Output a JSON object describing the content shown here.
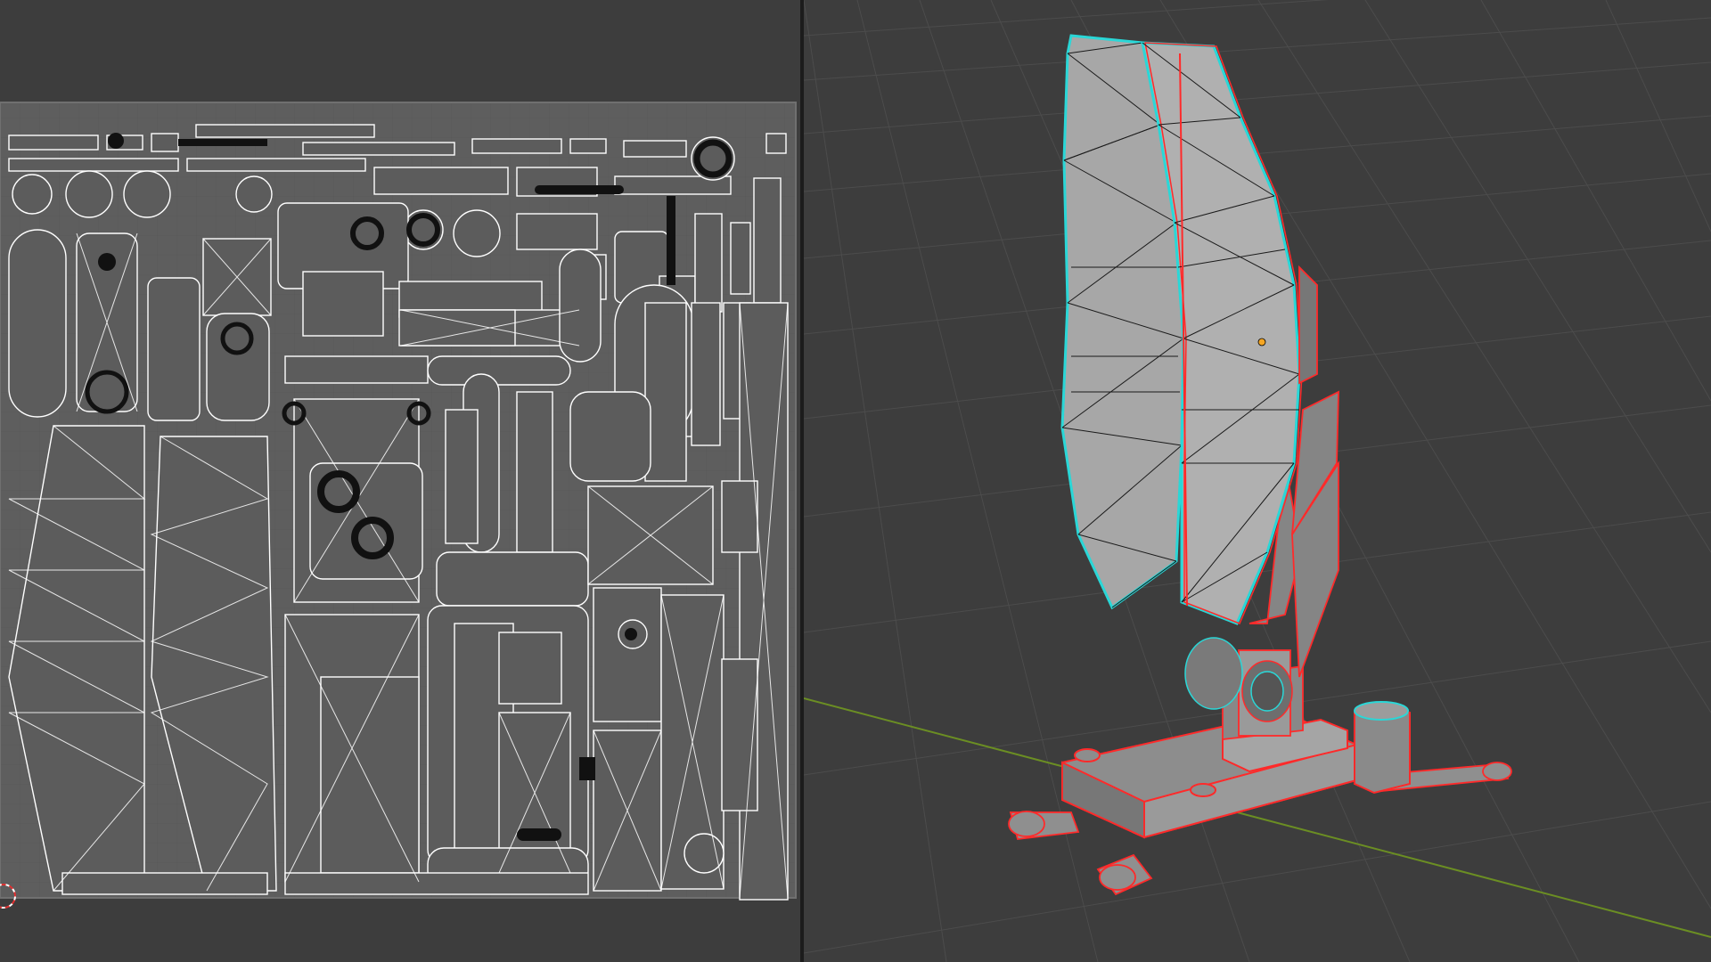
{
  "editors": {
    "uv_editor": {
      "kind": "UV Editor",
      "background_color": "#3d3d3d",
      "uv_image_fill": "#5c5c5c",
      "uv_edge_color": "#ffffff",
      "uv_vertex_color": "#000000",
      "cursor_icon": "2d-cursor-icon"
    },
    "viewport_3d": {
      "kind": "3D Viewport",
      "background_color": "#3d3d3d",
      "grid_color": "#4a4a4a",
      "x_axis_color": "#6b8e23",
      "object": "radar-antenna",
      "selection_outline_color": "#ff2a2a",
      "active_edge_color": "#2ad7d7",
      "origin_icon": "object-origin-icon"
    }
  }
}
